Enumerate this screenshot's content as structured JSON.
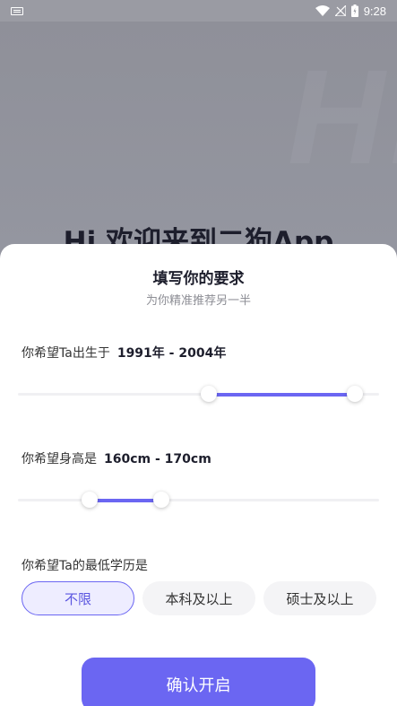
{
  "status_bar": {
    "time": "9:28"
  },
  "banner": {
    "watermark": "Hi",
    "welcome": "Hi 欢迎来到二狗App"
  },
  "sheet": {
    "title": "填写你的要求",
    "subtitle": "为你精准推荐另一半",
    "birth": {
      "label": "你希望Ta出生于",
      "value": "1991年 - 2004年"
    },
    "height": {
      "label": "你希望身高是",
      "value": "160cm - 170cm"
    },
    "education": {
      "label": "你希望Ta的最低学历是",
      "options": [
        "不限",
        "本科及以上",
        "硕士及以上"
      ],
      "selected_index": 0
    },
    "confirm_label": "确认开启"
  },
  "colors": {
    "accent": "#6b66f2",
    "background": "#8e8f99"
  }
}
